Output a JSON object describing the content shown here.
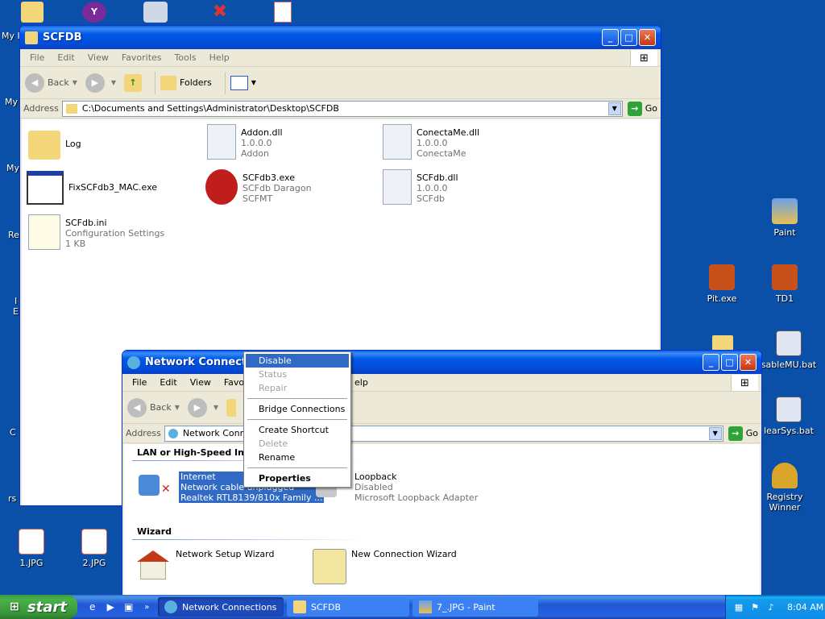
{
  "desktop": {
    "right_icons": [
      {
        "label": "Paint",
        "icon": "paint-icon"
      },
      {
        "label": "Pit.exe",
        "icon": "pit-exe-icon"
      },
      {
        "label": "TD1",
        "icon": "td1-icon"
      },
      {
        "label": "sableMU.bat",
        "icon": "batch-file-icon"
      },
      {
        "label": "learSys.bat",
        "icon": "batch-file-icon"
      },
      {
        "label": "Registry Winner",
        "icon": "trophy-icon"
      }
    ],
    "bottom_icons": [
      {
        "label": "1.JPG",
        "icon": "jpg-file-icon"
      },
      {
        "label": "2.JPG",
        "icon": "jpg-file-icon"
      }
    ],
    "cut_labels": [
      "My I",
      "My",
      "My",
      "Re",
      "I",
      "E",
      "C",
      "rs"
    ]
  },
  "scfdb_window": {
    "title": "SCFDB",
    "menu": [
      "File",
      "Edit",
      "View",
      "Favorites",
      "Tools",
      "Help"
    ],
    "toolbar": {
      "back": "Back",
      "folders": "Folders"
    },
    "address_label": "Address",
    "address_value": "C:\\Documents and Settings\\Administrator\\Desktop\\SCFDB",
    "go_label": "Go",
    "files": [
      {
        "name": "Log",
        "lines": []
      },
      {
        "name": "Addon.dll",
        "lines": [
          "1.0.0.0",
          "Addon"
        ]
      },
      {
        "name": "ConectaMe.dll",
        "lines": [
          "1.0.0.0",
          "ConectaMe"
        ]
      },
      {
        "name": "FixSCFdb3_MAC.exe",
        "lines": []
      },
      {
        "name": "SCFdb3.exe",
        "lines": [
          "SCFdb Daragon",
          "SCFMT"
        ]
      },
      {
        "name": "SCFdb.dll",
        "lines": [
          "1.0.0.0",
          "SCFdb"
        ]
      },
      {
        "name": "SCFdb.ini",
        "lines": [
          "Configuration Settings",
          "1 KB"
        ]
      }
    ]
  },
  "netconn_window": {
    "title": "Network Connection",
    "menu": [
      "File",
      "Edit",
      "View",
      "Favorit",
      "elp"
    ],
    "toolbar": {
      "back": "Back"
    },
    "address_label": "Address",
    "address_value": "Network Connec",
    "go_label": "Go",
    "section_lan": "LAN or High-Speed Inter",
    "section_wizard": "Wizard",
    "connections": [
      {
        "name": "Internet",
        "status": "Network cable unplugged",
        "device": "Realtek RTL8139/810x Family ..."
      },
      {
        "name": "Loopback",
        "status": "Disabled",
        "device": "Microsoft Loopback Adapter"
      }
    ],
    "wizards": [
      {
        "name": "Network Setup Wizard"
      },
      {
        "name": "New Connection Wizard"
      }
    ]
  },
  "context_menu": {
    "items": [
      {
        "label": "Disable",
        "state": "selected"
      },
      {
        "label": "Status",
        "state": "disabled"
      },
      {
        "label": "Repair",
        "state": "disabled"
      },
      {
        "label": "Bridge Connections",
        "state": "normal"
      },
      {
        "label": "Create Shortcut",
        "state": "normal"
      },
      {
        "label": "Delete",
        "state": "disabled"
      },
      {
        "label": "Rename",
        "state": "normal"
      },
      {
        "label": "Properties",
        "state": "bold"
      }
    ]
  },
  "taskbar": {
    "start_label": "start",
    "tasks": [
      {
        "label": "Network Connections",
        "active": true
      },
      {
        "label": "SCFDB",
        "active": false
      },
      {
        "label": "7_.JPG - Paint",
        "active": false
      }
    ],
    "clock": "8:04 AM"
  },
  "colors": {
    "desktop": "#0a4fa8",
    "titlebar": "#0058e6",
    "selection": "#316ac5",
    "start": "#3c9a3c"
  }
}
